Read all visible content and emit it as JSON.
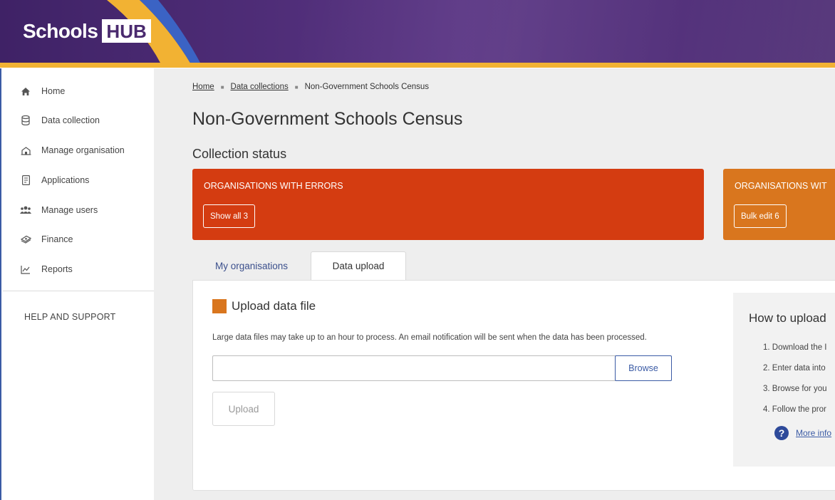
{
  "brand": {
    "name": "Schools",
    "badge": "HUB"
  },
  "sidebar": {
    "items": [
      {
        "label": "Home",
        "icon": "home-icon"
      },
      {
        "label": "Data collection",
        "icon": "database-icon"
      },
      {
        "label": "Manage organisation",
        "icon": "building-icon"
      },
      {
        "label": "Applications",
        "icon": "document-icon"
      },
      {
        "label": "Manage users",
        "icon": "users-icon"
      },
      {
        "label": "Finance",
        "icon": "money-icon"
      },
      {
        "label": "Reports",
        "icon": "chart-icon"
      }
    ],
    "help_label": "HELP AND SUPPORT"
  },
  "breadcrumb": {
    "home": "Home",
    "data_collections": "Data collections",
    "current": "Non-Government Schools Census"
  },
  "page_title": "Non-Government Schools Census",
  "collection_status": {
    "title": "Collection status",
    "errors_card": {
      "title": "ORGANISATIONS WITH ERRORS",
      "button": "Show all 3",
      "color": "#d43c11"
    },
    "warnings_card": {
      "title": "ORGANISATIONS WIT",
      "button": "Bulk edit 6",
      "color": "#d9761e"
    }
  },
  "tabs": [
    {
      "label": "My organisations",
      "active": false
    },
    {
      "label": "Data upload",
      "active": true
    }
  ],
  "upload": {
    "heading": "Upload data file",
    "note": "Large data files may take up to an hour to process. An email notification will be sent when the data has been processed.",
    "file_value": "",
    "browse_label": "Browse",
    "upload_label": "Upload"
  },
  "how_to": {
    "title": "How to upload",
    "steps": [
      "1. Download the I",
      "2. Enter data into",
      "3. Browse for you",
      "4. Follow the pror"
    ],
    "more_link": "More info"
  }
}
